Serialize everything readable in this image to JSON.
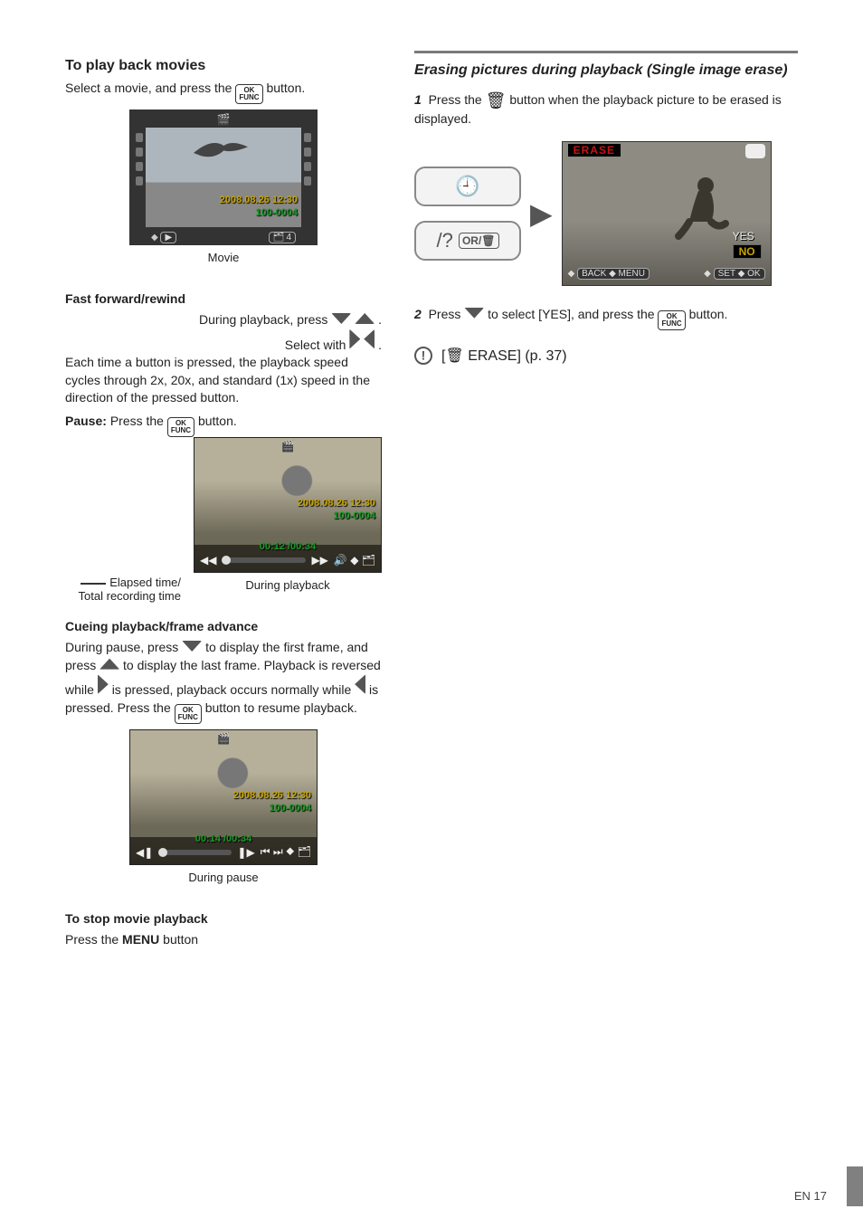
{
  "left": {
    "section_title": "To play back movies",
    "intro_pre": "Select a movie, and press the ",
    "intro_post": " button.",
    "movie_caption": "Movie",
    "movie_date": "2008.08.26 12:30",
    "movie_filenum": "100-0004",
    "movie_set_num": "4",
    "sub1_title": "Fast forward/rewind",
    "sub1_line1_pre": "During playback, press ",
    "sub1_line1_post": ".",
    "sub1_line2_pre": "Select with ",
    "sub1_line2_post": ".",
    "sub1_para": "Each time a button is pressed, the playback speed cycles through 2x, 20x, and standard (1x) speed in the direction of the pressed button.",
    "pause_line_pre": "Press the ",
    "pause_line_post": " button.",
    "pause_label": "Pause:",
    "elapsed_label_1": "Elapsed time/",
    "elapsed_label_2": "Total recording time",
    "playback_caption": "During playback",
    "playback_date": "2008.08.26 12:30",
    "playback_filenum": "100-0004",
    "playback_time": "00:12 /00:34",
    "sub2_title": "Cueing playback/frame advance",
    "sub2_para_1": "During pause, press ",
    "sub2_para_2": " to display the first frame, and press ",
    "sub2_para_3": " to display the last frame. Playback is reversed while ",
    "sub2_para_4": " is pressed, playback occurs normally while ",
    "sub2_para_5": " is pressed. Press the ",
    "sub2_para_6": " button to resume playback.",
    "pause_caption": "During pause",
    "pause_date": "2008.08.26 12:30",
    "pause_filenum": "100-0004",
    "pause_time": "00:14 /00:34",
    "stop_title": "To stop movie playback",
    "stop_line_pre": "Press the ",
    "stop_line_bold": "MENU",
    "stop_line_post": " button"
  },
  "right": {
    "title_main": "Erasing pictures during playback (Single image erase)",
    "step1_pre": "Press the ",
    "step1_post": " button when the playback picture to be erased is displayed.",
    "btn_top_glyph": "🕘",
    "btn_bottom_left": "/?",
    "btn_bottom_mid": "OR/",
    "erase_title": "ERASE",
    "erase_yes": "YES",
    "erase_no": "NO",
    "erase_back": "BACK ◆ MENU",
    "erase_set": "SET ◆ OK",
    "step2_pre": "Press ",
    "step2_mid": " to select [YES], and press the ",
    "step2_post": " button.",
    "note_text": "[🗑 ERASE] (p. 37)",
    "ok_top": "OK",
    "ok_bot": "FUNC"
  },
  "page_number": "EN 17"
}
